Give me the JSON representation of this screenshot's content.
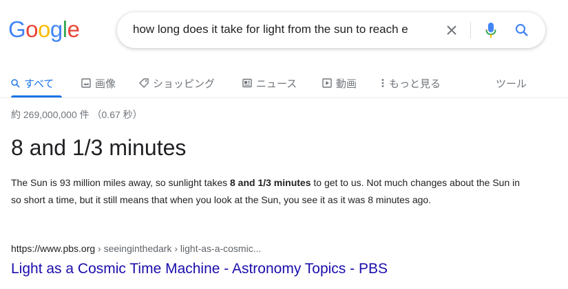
{
  "logo": {
    "letters": [
      "G",
      "o",
      "o",
      "g",
      "l",
      "e"
    ],
    "colors": [
      "#4285F4",
      "#EA4335",
      "#FBBC05",
      "#4285F4",
      "#34A853",
      "#EA4335"
    ]
  },
  "search": {
    "query": "how long does it take for light from the sun to reach e",
    "icons": {
      "clear": "close-icon",
      "mic": "mic-icon",
      "search": "search-icon"
    }
  },
  "tabs": [
    {
      "label": "すべて",
      "icon": "search-icon",
      "active": true
    },
    {
      "label": "画像",
      "icon": "image-icon"
    },
    {
      "label": "ショッピング",
      "icon": "tag-icon"
    },
    {
      "label": "ニュース",
      "icon": "news-icon"
    },
    {
      "label": "動画",
      "icon": "play-icon"
    },
    {
      "label": "もっと見る",
      "icon": "more-vert-icon"
    }
  ],
  "tools_label": "ツール",
  "stats": "約 269,000,000 件 （0.67 秒）",
  "answer": "8 and 1/3 minutes",
  "snippet": {
    "before": "The Sun is 93 million miles away, so sunlight takes ",
    "bold": "8 and 1/3 minutes",
    "after": " to get to us. Not much changes about the Sun in so short a time, but it still means that when you look at the Sun, you see it as it was 8 minutes ago."
  },
  "result": {
    "domain": "https://www.pbs.org",
    "path": " › seeinginthedark › light-as-a-cosmic...",
    "title": "Light as a Cosmic Time Machine - Astronomy Topics - PBS"
  },
  "colors": {
    "accent": "#1a73e8",
    "link": "#1a0dab",
    "muted": "#70757a"
  }
}
